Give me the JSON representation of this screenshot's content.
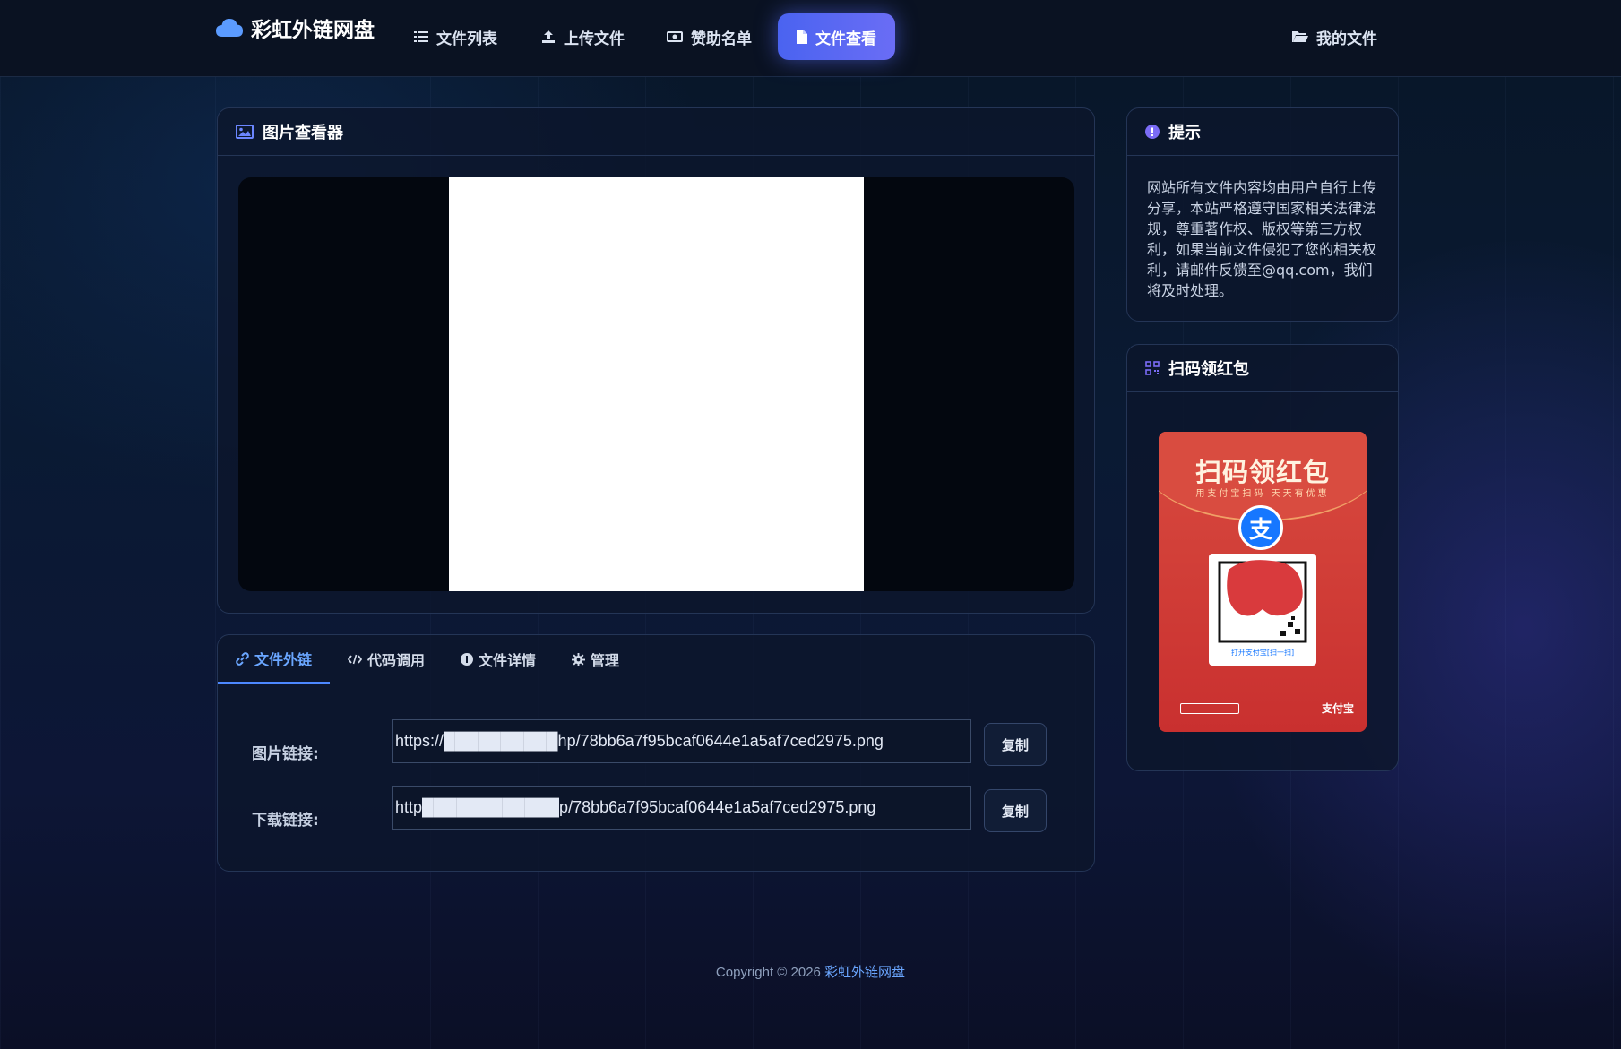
{
  "brand": {
    "name": "彩虹外链网盘"
  },
  "nav": {
    "file_list": "文件列表",
    "upload": "上传文件",
    "sponsors": "赞助名单",
    "file_view": "文件查看",
    "my_files": "我的文件"
  },
  "viewer": {
    "title": "图片查看器"
  },
  "tabs": [
    {
      "label": "文件外链"
    },
    {
      "label": "代码调用"
    },
    {
      "label": "文件详情"
    },
    {
      "label": "管理"
    }
  ],
  "links": {
    "image_label": "图片链接:",
    "image_value": "https://██████████hp/78bb6a7f95bcaf0644e1a5af7ced2975.png",
    "download_label": "下载链接:",
    "download_value": "http████████████p/78bb6a7f95bcaf0644e1a5af7ced2975.png",
    "copy_label": "复制"
  },
  "tip": {
    "title": "提示",
    "text": "网站所有文件内容均由用户自行上传分享，本站严格遵守国家相关法律法规，尊重著作权、版权等第三方权利，如果当前文件侵犯了您的相关权利，请邮件反馈至@qq.com，我们将及时处理。"
  },
  "redpacket": {
    "title": "扫码领红包",
    "envelope_title": "扫码领红包",
    "envelope_subtitle": "用支付宝扫码 天天有优惠",
    "qr_caption": "打开支付宝[扫一扫]",
    "brand": "支付宝"
  },
  "footer": {
    "prefix": "Copyright © 2026 ",
    "site": "彩虹外链网盘"
  },
  "colors": {
    "accent": "#4a63f0",
    "link": "#6aa6ff",
    "envelope_red": "#c9302f",
    "alipay_blue": "#1677ff"
  }
}
